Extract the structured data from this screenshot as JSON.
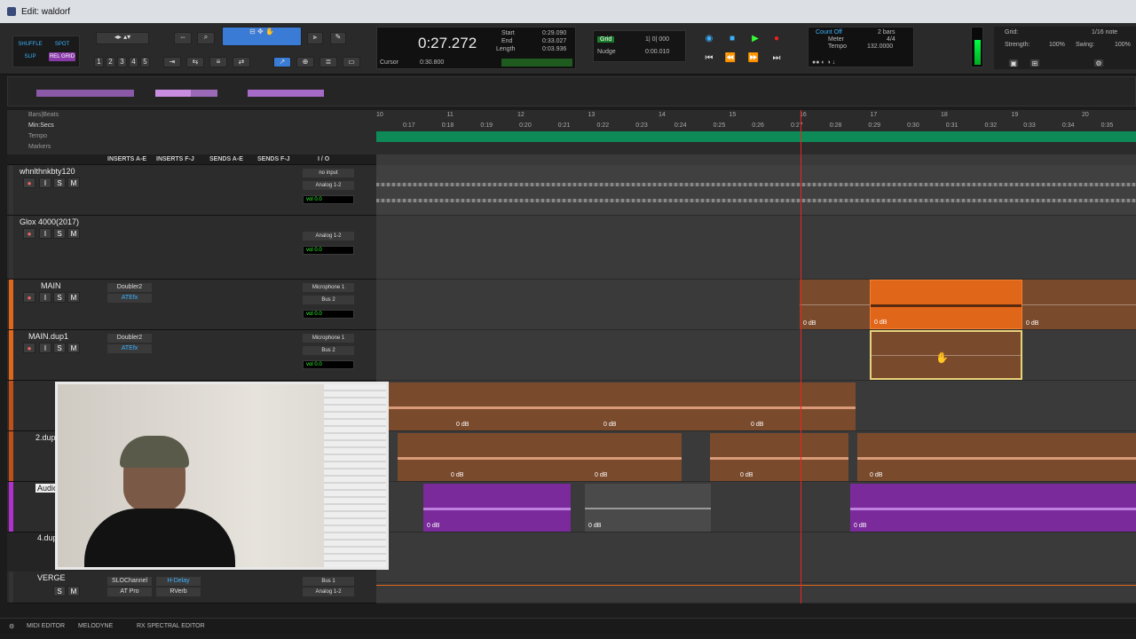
{
  "window": {
    "title": "Edit: waldorf"
  },
  "modes": {
    "shuffle": "SHUFFLE",
    "spot": "SPOT",
    "slip": "SLIP",
    "grid": "REL GRID"
  },
  "zoom_presets": [
    "1",
    "2",
    "3",
    "4",
    "5"
  ],
  "counter": {
    "main": "0:27.272",
    "cursor_label": "Cursor",
    "cursor_value": "0:30.800",
    "start_label": "Start",
    "end_label": "End",
    "length_label": "Length",
    "start": "0:29.090",
    "end": "0:33.027",
    "length": "0:03.936"
  },
  "grid_nudge": {
    "grid_label": "Grid",
    "grid_value": "1| 0| 000",
    "nudge_label": "Nudge",
    "nudge_value": "0:00.010"
  },
  "count_tempo": {
    "count": "Count Off",
    "meter_label": "Meter",
    "tempo_label": "Tempo",
    "bars": "2 bars",
    "meter": "4/4",
    "tempo": "132.0000"
  },
  "grid_settings": {
    "grid_label": "Grid:",
    "grid_value": "1/16 note",
    "strength_label": "Strength:",
    "strength": "100%",
    "swing_label": "Swing:",
    "swing": "100%"
  },
  "rulers": {
    "bars_label": "Bars|Beats",
    "minsecs_label": "Min:Secs",
    "tempo_label": "Tempo",
    "markers_label": "Markers",
    "bars": [
      "10",
      "11",
      "12",
      "13",
      "14",
      "15",
      "16",
      "17",
      "18",
      "19",
      "20"
    ],
    "secs": [
      "0:17",
      "0:18",
      "0:19",
      "0:20",
      "0:21",
      "0:22",
      "0:23",
      "0:24",
      "0:25",
      "0:26",
      "0:27",
      "0:28",
      "0:29",
      "0:30",
      "0:31",
      "0:32",
      "0:33",
      "0:34",
      "0:35"
    ]
  },
  "columns": {
    "inserts_ae": "INSERTS A-E",
    "inserts_fj": "INSERTS F-J",
    "sends_ae": "SENDS A-E",
    "sends_fj": "SENDS F-J",
    "io": "I / O"
  },
  "tracks": [
    {
      "name": "whnlthnkbty120",
      "io_in": "no input",
      "io_out": "Analog 1-2",
      "vol": "vol",
      "vol_val": "0.0",
      "pan": "100",
      "pan2": "100"
    },
    {
      "name": "Glox 4000(2017)",
      "io_in": "",
      "io_out": "Analog 1-2",
      "vol": "vol",
      "vol_val": "0.0",
      "pan": "100",
      "pan2": "100"
    },
    {
      "name": "MAIN",
      "insert1": "Doubler2",
      "insert2": "ATEfx",
      "io_in": "Microphone 1",
      "io_out": "Bus 2",
      "vol": "vol",
      "vol_val": "0.0"
    },
    {
      "name": "MAIN.dup1",
      "insert1": "Doubler2",
      "insert2": "ATEfx",
      "io_in": "Microphone 1",
      "io_out": "Bus 2",
      "vol": "vol",
      "vol_val": "0.0"
    },
    {
      "name": "2.dup"
    },
    {
      "name": "Audio"
    },
    {
      "name": "4.dup"
    },
    {
      "name": "VERGE",
      "insert1": "SLOChannel",
      "insert2": "AT Pro",
      "insert3": "H-Delay",
      "insert4": "RVerb",
      "io_in": "Bus 1",
      "io_out": "Analog 1-2"
    }
  ],
  "clip_db": "0 dB",
  "bottom": {
    "midi": "MIDI EDITOR",
    "melodyne": "MELODYNE",
    "rx": "RX SPECTRAL EDITOR"
  },
  "colors": {
    "orange": "#e0661a",
    "brown": "#7a4a2c",
    "purple": "#7a2a9a",
    "playhead": "#e22222",
    "tempo": "#0e8a58",
    "blue_sel": "#3a7bd5"
  }
}
